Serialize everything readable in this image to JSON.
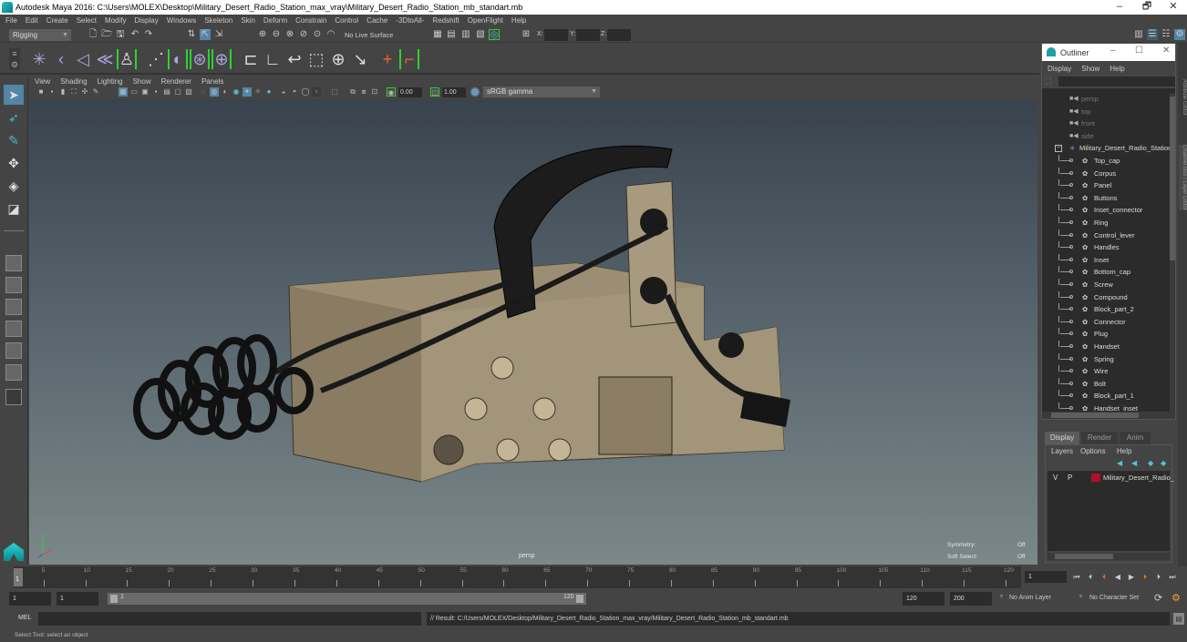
{
  "window": {
    "title": "Autodesk Maya 2016: C:\\Users\\MOLEX\\Desktop\\Military_Desert_Radio_Station_max_vray\\Military_Desert_Radio_Station_mb_standart.mb",
    "minimize": "–",
    "maximize": "🗗",
    "close": "✕"
  },
  "menubar": [
    "File",
    "Edit",
    "Create",
    "Select",
    "Modify",
    "Display",
    "Windows",
    "Skeleton",
    "Skin",
    "Deform",
    "Constrain",
    "Control",
    "Cache",
    "-3DtoAll-",
    "Redshift",
    "OpenFlight",
    "Help"
  ],
  "statusline": {
    "menuset": "Rigging",
    "live_surface": "No Live Surface",
    "x_label": "X:",
    "y_label": "Y:",
    "z_label": "Z:",
    "x_value": "",
    "y_value": "",
    "z_value": ""
  },
  "viewport": {
    "menu": [
      "View",
      "Shading",
      "Lighting",
      "Show",
      "Renderer",
      "Panels"
    ],
    "exposure": "0.00",
    "gamma": "1.00",
    "color_space": "sRGB gamma",
    "camera": "persp",
    "hud": {
      "symmetry_label": "Symmetry:",
      "symmetry_value": "Off",
      "soft_select_label": "Soft Select:",
      "soft_select_value": "Off"
    }
  },
  "outliner": {
    "title": "Outliner",
    "menu": [
      "Display",
      "Show",
      "Help"
    ],
    "search_value": "",
    "cameras": [
      "persp",
      "top",
      "front",
      "side"
    ],
    "group": "Military_Desert_Radio_Station",
    "children": [
      "Top_cap",
      "Corpus",
      "Panel",
      "Buttons",
      "Inset_connector",
      "Ring",
      "Control_lever",
      "Handles",
      "Inset",
      "Bottom_cap",
      "Screw",
      "Compound",
      "Block_part_2",
      "Connector",
      "Plug",
      "Handset",
      "Spring",
      "Wire",
      "Bolt",
      "Block_part_1",
      "Handset_inset"
    ]
  },
  "side_tabs": [
    "Attribute Editor",
    "Channel Box / Layer Editor"
  ],
  "layer_editor": {
    "tabs": [
      "Display",
      "Render",
      "Anim"
    ],
    "active_tab": "Display",
    "menu": [
      "Layers",
      "Options",
      "Help"
    ],
    "layers": [
      {
        "visible": "V",
        "playback": "P",
        "color": "#b0102a",
        "name": "Military_Desert_Radio_"
      }
    ]
  },
  "timeslider": {
    "ticks": [
      "5",
      "10",
      "15",
      "20",
      "25",
      "30",
      "35",
      "40",
      "45",
      "50",
      "55",
      "60",
      "65",
      "70",
      "75",
      "80",
      "85",
      "90",
      "95",
      "100",
      "105",
      "110",
      "115",
      "120"
    ],
    "current_frame_marker": "1",
    "current_frame": "1"
  },
  "rangeslider": {
    "start": "1",
    "anim_start": "1",
    "range_start": "1",
    "range_end": "120",
    "anim_end": "120",
    "end": "200",
    "anim_layer": "No Anim Layer",
    "character_set": "No Character Set"
  },
  "cmdline": {
    "label": "MEL",
    "input": "",
    "result": "// Result: C:/Users/MOLEX/Desktop/Military_Desert_Radio_Station_max_vray/Military_Desert_Radio_Station_mb_standart.mb"
  },
  "helpline": "Select Tool: select an object",
  "colors": {
    "accent": "#5285a6",
    "highlight_green": "#2fd12f",
    "layer_color": "#b0102a"
  }
}
